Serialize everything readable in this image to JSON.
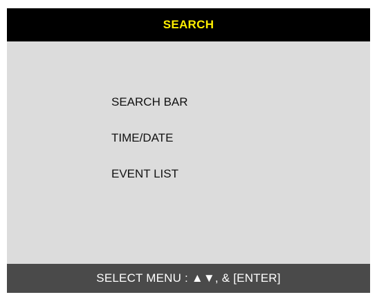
{
  "header": {
    "title": "SEARCH"
  },
  "menu": {
    "items": [
      {
        "label": "SEARCH BAR"
      },
      {
        "label": "TIME/DATE"
      },
      {
        "label": "EVENT LIST"
      }
    ]
  },
  "footer": {
    "hint": "SELECT MENU : ▲▼, & [ENTER]"
  },
  "colors": {
    "title_bar": "#000000",
    "title_text": "#ffee00",
    "panel_background": "#dcdcdc",
    "footer_bar": "#4a4a4a",
    "footer_text": "#ffffff"
  }
}
